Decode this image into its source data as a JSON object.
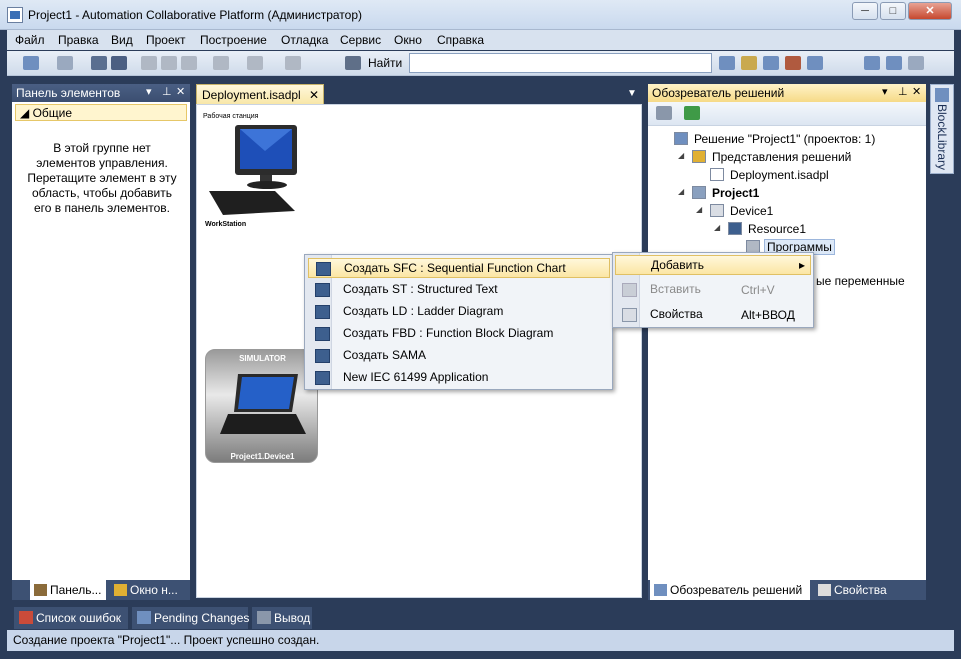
{
  "window": {
    "title": "Project1 - Automation Collaborative Platform (Администратор)",
    "minimize": "─",
    "maximize": "□",
    "close": "✕"
  },
  "menubar": [
    "Файл",
    "Правка",
    "Вид",
    "Проект",
    "Построение",
    "Отладка",
    "Сервис",
    "Окно",
    "Справка"
  ],
  "toolbar": {
    "find_label": "Найти",
    "find_value": ""
  },
  "toolbox": {
    "title": "Панель элементов",
    "group": "◢ Общие",
    "empty_message": "В этой группе нет элементов управления. Перетащите элемент в эту область, чтобы добавить его в панель элементов.",
    "tabs": [
      "Панель...",
      "Окно н..."
    ]
  },
  "document": {
    "tab": "Deployment.isadpl",
    "workstation_label_top": "Рабочая станция",
    "workstation_label_bottom": "WorkStation",
    "simulator_label_top": "SIMULATOR",
    "simulator_label_bottom": "Project1.Device1"
  },
  "explorer": {
    "title": "Обозреватель решений",
    "partial_item": "ые переменные",
    "tree": [
      {
        "label": "Решение \"Project1\"  (проектов: 1)",
        "depth": 0,
        "expander": ""
      },
      {
        "label": "Представления решений",
        "depth": 1,
        "expander": "◢"
      },
      {
        "label": "Deployment.isadpl",
        "depth": 2,
        "expander": ""
      },
      {
        "label": "Project1",
        "depth": 1,
        "expander": "◢",
        "bold": true
      },
      {
        "label": "Device1",
        "depth": 2,
        "expander": "◢"
      },
      {
        "label": "Resource1",
        "depth": 3,
        "expander": "◢"
      },
      {
        "label": "Программы",
        "depth": 4,
        "expander": "",
        "selected": true
      }
    ],
    "tabs": [
      "Обозреватель решений",
      "Свойства"
    ]
  },
  "side_strip": {
    "label": "BlockLibrary"
  },
  "bottom_windows": [
    "Список ошибок",
    "Pending Changes",
    "Вывод"
  ],
  "status": "Создание проекта \"Project1\"... Проект успешно создан.",
  "context_menu": {
    "items": [
      {
        "label": "Добавить",
        "arrow": "▸"
      },
      {
        "label": "Вставить",
        "shortcut": "Ctrl+V",
        "disabled": true
      },
      {
        "label": "Свойства",
        "shortcut": "Alt+ВВОД"
      }
    ]
  },
  "submenu": {
    "items": [
      "Создать SFC : Sequential Function Chart",
      "Создать ST : Structured Text",
      "Создать LD : Ladder Diagram",
      "Создать FBD : Function Block Diagram",
      "Создать SAMA",
      "New IEC 61499 Application"
    ]
  },
  "colors": {
    "frame": "#2b3c59",
    "active_header": "#f6da87",
    "highlight": "#fbe6a4"
  }
}
